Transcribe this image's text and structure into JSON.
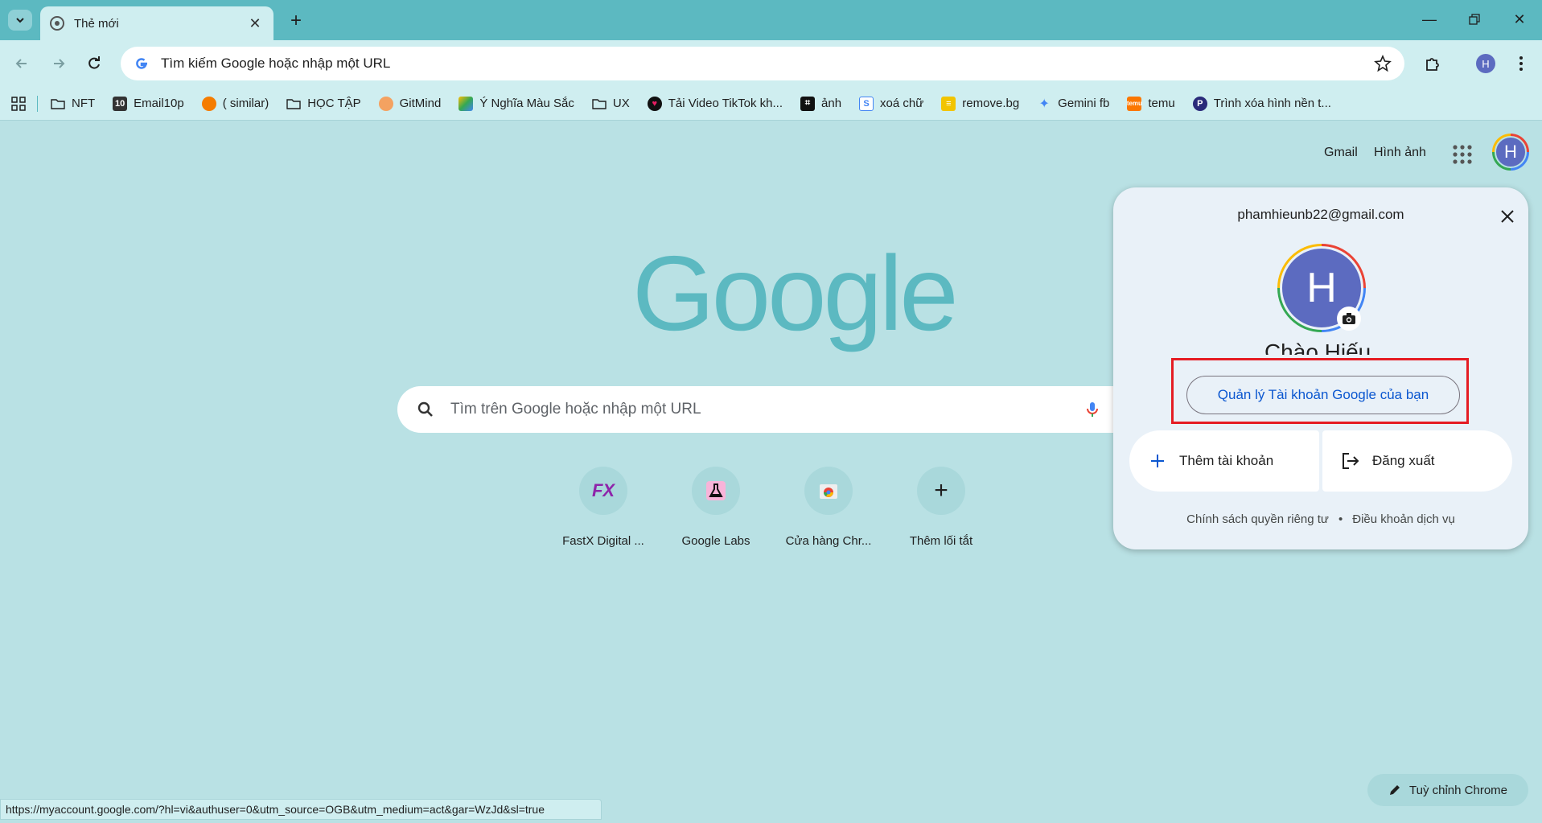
{
  "browser": {
    "tab_title": "Thẻ mới",
    "omnibox_text": "Tìm kiếm Google hoặc nhập một URL",
    "profile_initial": "H"
  },
  "bookmarks": [
    {
      "label": "NFT",
      "icon": "folder-icon"
    },
    {
      "label": "Email10p",
      "icon": "email10p-icon"
    },
    {
      "label": "( similar)",
      "icon": "similar-icon"
    },
    {
      "label": "HỌC TẬP",
      "icon": "folder-icon"
    },
    {
      "label": "GitMind",
      "icon": "gitmind-icon"
    },
    {
      "label": "Ý Nghĩa Màu Sắc",
      "icon": "color-icon"
    },
    {
      "label": "UX",
      "icon": "folder-icon"
    },
    {
      "label": "Tải Video TikTok kh...",
      "icon": "tiktok-icon"
    },
    {
      "label": "ảnh",
      "icon": "image-icon"
    },
    {
      "label": "xoá chữ",
      "icon": "eraser-icon"
    },
    {
      "label": "remove.bg",
      "icon": "removebg-icon"
    },
    {
      "label": "Gemini fb",
      "icon": "gemini-icon"
    },
    {
      "label": "temu",
      "icon": "temu-icon"
    },
    {
      "label": "Trình xóa hình nền t...",
      "icon": "bg-remover-icon"
    }
  ],
  "page": {
    "gmail_link": "Gmail",
    "images_link": "Hình ảnh",
    "logo_text": "Google",
    "search_placeholder": "Tìm trên Google hoặc nhập một URL",
    "shortcuts": [
      {
        "label": "FastX Digital ...",
        "icon": "fastx-icon"
      },
      {
        "label": "Google Labs",
        "icon": "labs-flask-icon"
      },
      {
        "label": "Cửa hàng Chr...",
        "icon": "chrome-store-icon"
      },
      {
        "label": "Thêm lối tắt",
        "icon": "plus-icon"
      }
    ],
    "customize_label": "Tuỳ chỉnh Chrome"
  },
  "account_popup": {
    "email": "phamhieunb22@gmail.com",
    "avatar_initial": "H",
    "greeting": "Chào Hiếu,",
    "manage_label": "Quản lý Tài khoản Google của bạn",
    "add_account_label": "Thêm tài khoản",
    "sign_out_label": "Đăng xuất",
    "privacy_label": "Chính sách quyền riêng tư",
    "separator": "•",
    "terms_label": "Điều khoản dịch vụ"
  },
  "status_url": "https://myaccount.google.com/?hl=vi&authuser=0&utm_source=OGB&utm_medium=act&gar=WzJd&sl=true",
  "colors": {
    "page_bg": "#b9e1e4",
    "accent": "#5cb9c1",
    "highlight_box": "#e51c23",
    "link_blue": "#0b57d0"
  }
}
